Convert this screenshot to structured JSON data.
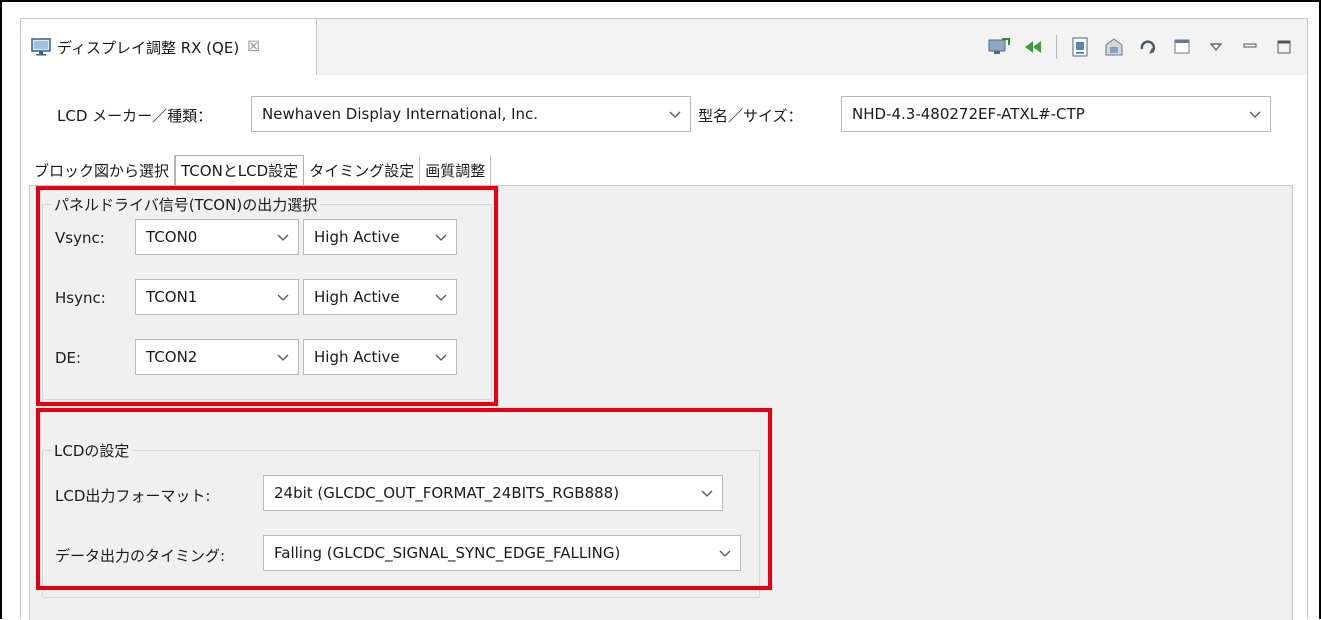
{
  "view": {
    "title": "ディスプレイ調整 RX (QE)",
    "close_symbol": "☒",
    "icon": "monitor-icon"
  },
  "toolbar": {
    "icons": [
      "import-monitor-icon",
      "rewind-icon",
      "document-icon",
      "export-icon",
      "refresh-icon",
      "window-icon",
      "view-menu-icon",
      "minimize-icon",
      "maximize-icon"
    ]
  },
  "header": {
    "maker_label": "LCD メーカー／種類：",
    "maker_value": "Newhaven Display International, Inc.",
    "model_label": "型名／サイズ：",
    "model_value": "NHD-4.3-480272EF-ATXL#-CTP"
  },
  "tabs": [
    {
      "label": "ブロック図から選択",
      "active": false
    },
    {
      "label": "TCONとLCD設定",
      "active": true
    },
    {
      "label": "タイミング設定",
      "active": false
    },
    {
      "label": "画質調整",
      "active": false
    }
  ],
  "tcon_group": {
    "title": "パネルドライバ信号(TCON)の出力選択",
    "rows": [
      {
        "label": "Vsync:",
        "tcon": "TCON0",
        "polarity": "High Active"
      },
      {
        "label": "Hsync:",
        "tcon": "TCON1",
        "polarity": "High Active"
      },
      {
        "label": "DE:",
        "tcon": "TCON2",
        "polarity": "High Active"
      }
    ]
  },
  "lcd_group": {
    "title": "LCDの設定",
    "format_label": "LCD出力フォーマット:",
    "format_value": "24bit (GLCDC_OUT_FORMAT_24BITS_RGB888)",
    "timing_label": "データ出力のタイミング:",
    "timing_value": "Falling (GLCDC_SIGNAL_SYNC_EDGE_FALLING)"
  },
  "colors": {
    "highlight": "#e60012",
    "panel_bg": "#f0f0f0",
    "border": "#b9b9b9"
  }
}
